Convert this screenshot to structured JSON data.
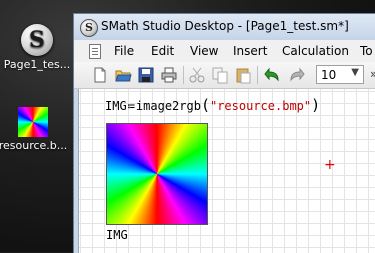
{
  "desktop": {
    "icons": [
      {
        "label": "Page1_tes...",
        "kind": "smath"
      },
      {
        "label": "resource.b...",
        "kind": "bitmap"
      }
    ]
  },
  "window": {
    "title": "SMath Studio Desktop - [Page1_test.sm*]",
    "app_icon_glyph": "S"
  },
  "menu": {
    "items": [
      "File",
      "Edit",
      "View",
      "Insert",
      "Calculation",
      "To"
    ]
  },
  "toolbar": {
    "font_size": "10",
    "dropdown_arrow": "▼",
    "more": "»"
  },
  "worksheet": {
    "expression": {
      "lhs": "IMG",
      "assign": "≔",
      "function": "image2rgb",
      "open_paren": "(",
      "argument": "\"resource.bmp\"",
      "close_paren": ")"
    },
    "result_label": "IMG",
    "cursor": "+"
  }
}
